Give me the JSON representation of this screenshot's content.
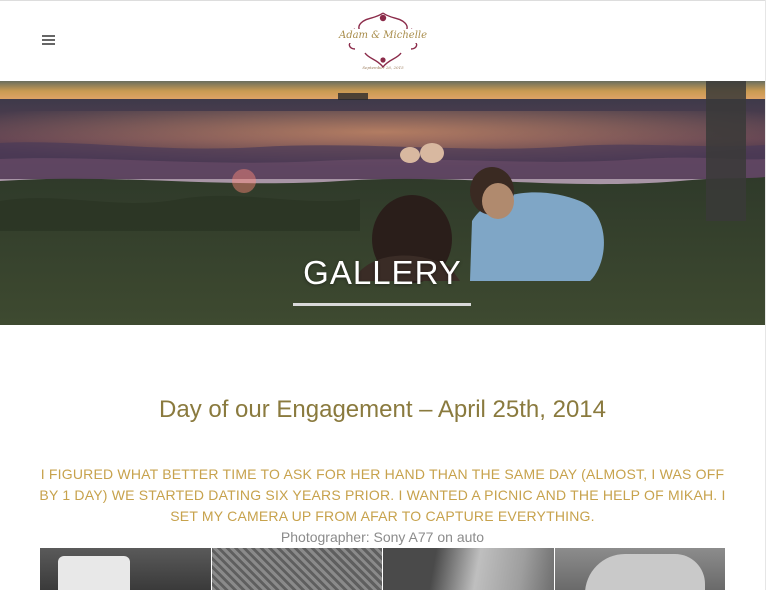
{
  "header": {
    "menu_icon": "hamburger-menu-icon",
    "logo": {
      "names": "Adam & Michelle",
      "date": "September 26, 2015",
      "accent_color": "#8b2b4a"
    }
  },
  "hero": {
    "title": "GALLERY"
  },
  "section": {
    "title": "Day of our Engagement – April 25th, 2014",
    "intro": "I FIGURED WHAT BETTER TIME TO ASK FOR HER HAND THAN THE SAME DAY (ALMOST, I WAS OFF BY 1 DAY) WE STARTED DATING SIX YEARS PRIOR. I WANTED A PICNIC AND THE HELP OF MIKAH. I SET MY CAMERA UP FROM AFAR TO CAPTURE EVERYTHING.",
    "photographer": "Photographer: Sony A77 on auto"
  },
  "colors": {
    "title_gold": "#8a7a3e",
    "intro_gold": "#c7a24c",
    "caption_gray": "#8b8b8b"
  }
}
